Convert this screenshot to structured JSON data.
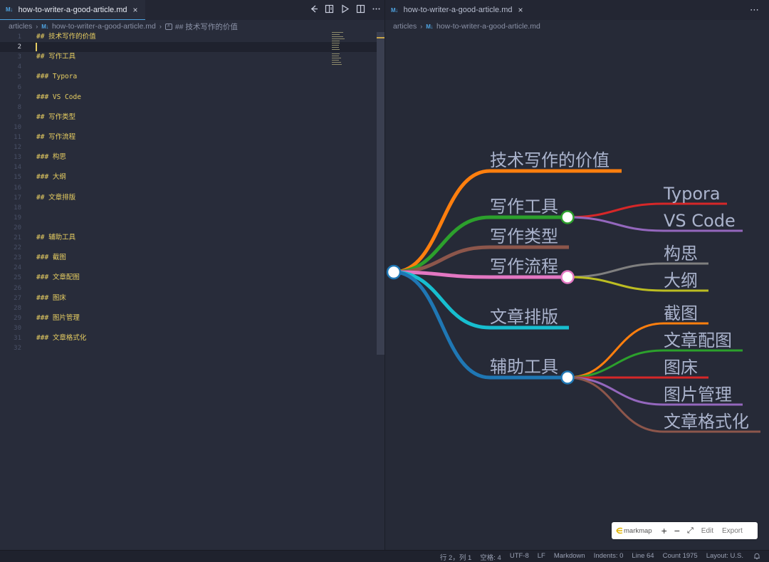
{
  "left": {
    "tab_title": "how-to-writer-a-good-article.md",
    "tab_icon": "M↓",
    "close": "×",
    "actions": [
      "compare-changes-icon",
      "open-preview-icon",
      "run-icon",
      "split-editor-icon",
      "more-actions-icon"
    ],
    "breadcrumb": [
      "articles",
      "how-to-writer-a-good-article.md",
      "## 技术写作的价值"
    ],
    "lines": [
      {
        "n": "1",
        "text": "## 技术写作的价值"
      },
      {
        "n": "2",
        "text": ""
      },
      {
        "n": "3",
        "text": "## 写作工具"
      },
      {
        "n": "4",
        "text": ""
      },
      {
        "n": "5",
        "text": "### Typora"
      },
      {
        "n": "6",
        "text": ""
      },
      {
        "n": "7",
        "text": "### VS Code"
      },
      {
        "n": "8",
        "text": ""
      },
      {
        "n": "9",
        "text": "## 写作类型"
      },
      {
        "n": "10",
        "text": ""
      },
      {
        "n": "11",
        "text": "## 写作流程"
      },
      {
        "n": "12",
        "text": ""
      },
      {
        "n": "13",
        "text": "### 构思"
      },
      {
        "n": "14",
        "text": ""
      },
      {
        "n": "15",
        "text": "### 大纲"
      },
      {
        "n": "16",
        "text": ""
      },
      {
        "n": "17",
        "text": "## 文章排版"
      },
      {
        "n": "18",
        "text": ""
      },
      {
        "n": "19",
        "text": ""
      },
      {
        "n": "20",
        "text": ""
      },
      {
        "n": "21",
        "text": "## 辅助工具"
      },
      {
        "n": "22",
        "text": ""
      },
      {
        "n": "23",
        "text": "### 截图"
      },
      {
        "n": "24",
        "text": ""
      },
      {
        "n": "25",
        "text": "### 文章配图"
      },
      {
        "n": "26",
        "text": ""
      },
      {
        "n": "27",
        "text": "### 图床"
      },
      {
        "n": "28",
        "text": ""
      },
      {
        "n": "29",
        "text": "### 图片管理"
      },
      {
        "n": "30",
        "text": ""
      },
      {
        "n": "31",
        "text": "### 文章格式化"
      },
      {
        "n": "32",
        "text": ""
      }
    ],
    "current_line": 2
  },
  "right": {
    "tab_title": "how-to-writer-a-good-article.md",
    "tab_icon": "M↓",
    "close": "×",
    "more": "⋯",
    "breadcrumb": [
      "articles",
      "how-to-writer-a-good-article.md"
    ]
  },
  "mindmap": {
    "branches": [
      {
        "label": "技术写作的价值",
        "color": "#ff7f0e",
        "children": []
      },
      {
        "label": "写作工具",
        "color": "#2ca02c",
        "children": [
          {
            "label": "Typora",
            "color": "#d62728"
          },
          {
            "label": "VS Code",
            "color": "#9467bd"
          }
        ]
      },
      {
        "label": "写作类型",
        "color": "#8c564b",
        "children": []
      },
      {
        "label": "写作流程",
        "color": "#e377c2",
        "children": [
          {
            "label": "构思",
            "color": "#7f7f7f"
          },
          {
            "label": "大纲",
            "color": "#bcbd22"
          }
        ]
      },
      {
        "label": "文章排版",
        "color": "#17becf",
        "children": []
      },
      {
        "label": "辅助工具",
        "color": "#1f77b4",
        "children": [
          {
            "label": "截图",
            "color": "#ff7f0e"
          },
          {
            "label": "文章配图",
            "color": "#2ca02c"
          },
          {
            "label": "图床",
            "color": "#d62728"
          },
          {
            "label": "图片管理",
            "color": "#9467bd"
          },
          {
            "label": "文章格式化",
            "color": "#8c564b"
          }
        ]
      }
    ]
  },
  "toolbar": {
    "brand": "markmap",
    "zoom_in": "+",
    "zoom_out": "−",
    "fit": "⤢",
    "edit": "Edit",
    "export": "Export"
  },
  "status": {
    "position": "行 2，列 1",
    "spaces": "空格: 4",
    "encoding": "UTF-8",
    "eol": "LF",
    "language": "Markdown",
    "indents": "Indents: 0",
    "line": "Line 64",
    "count": "Count 1975",
    "layout": "Layout: U.S."
  }
}
